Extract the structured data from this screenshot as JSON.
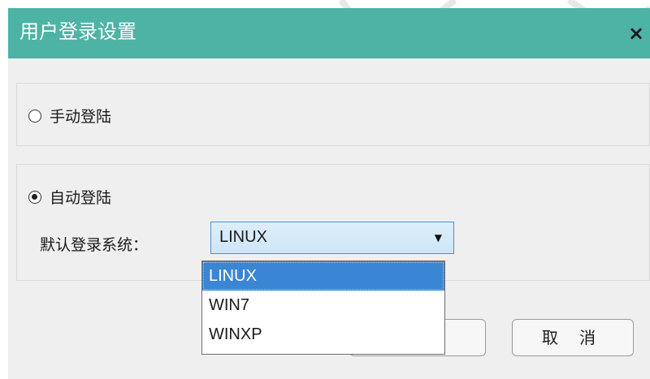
{
  "dialog": {
    "title": "用户登录设置",
    "close_label": "×"
  },
  "login": {
    "manual_label": "手动登陆",
    "auto_label": "自动登陆",
    "selected_mode": "auto",
    "default_system_label": "默认登录系统：",
    "default_system_value": "LINUX",
    "options": [
      "LINUX",
      "WIN7",
      "WINXP"
    ],
    "highlighted_option": "LINUX"
  },
  "buttons": {
    "ok_label": "",
    "cancel_label": "取 消"
  },
  "colors": {
    "titlebar": "#4cb3a5",
    "selection": "#3a86d4"
  },
  "icons": {
    "close": "close-icon",
    "dropdown": "chevron-down-icon"
  }
}
